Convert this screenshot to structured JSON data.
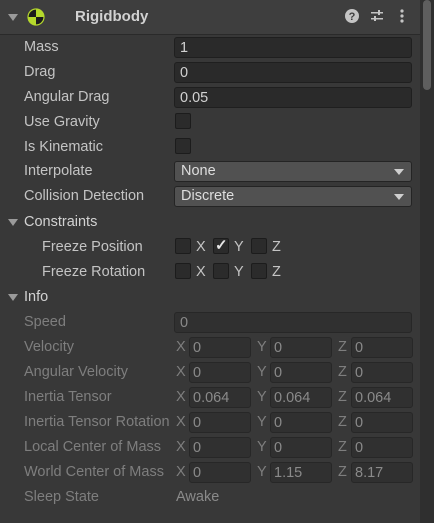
{
  "component": {
    "title": "Rigidbody",
    "icons": [
      "rigidbody-icon",
      "help-icon",
      "presets-icon",
      "more-icon"
    ]
  },
  "props": {
    "mass": {
      "label": "Mass",
      "value": "1"
    },
    "drag": {
      "label": "Drag",
      "value": "0"
    },
    "angular_drag": {
      "label": "Angular Drag",
      "value": "0.05"
    },
    "use_gravity": {
      "label": "Use Gravity",
      "checked": false
    },
    "is_kinematic": {
      "label": "Is Kinematic",
      "checked": false
    },
    "interpolate": {
      "label": "Interpolate",
      "value": "None"
    },
    "collision_detection": {
      "label": "Collision Detection",
      "value": "Discrete"
    }
  },
  "constraints": {
    "label": "Constraints",
    "freeze_position": {
      "label": "Freeze Position",
      "x": false,
      "y": true,
      "z": false
    },
    "freeze_rotation": {
      "label": "Freeze Rotation",
      "x": false,
      "y": false,
      "z": false
    }
  },
  "axes": {
    "x": "X",
    "y": "Y",
    "z": "Z"
  },
  "check_glyph": "✓",
  "info": {
    "label": "Info",
    "speed": {
      "label": "Speed",
      "value": "0"
    },
    "velocity": {
      "label": "Velocity",
      "x": "0",
      "y": "0",
      "z": "0"
    },
    "angular_velocity": {
      "label": "Angular Velocity",
      "x": "0",
      "y": "0",
      "z": "0"
    },
    "inertia_tensor": {
      "label": "Inertia Tensor",
      "x": "0.064",
      "y": "0.064",
      "z": "0.064"
    },
    "inertia_tensor_rotation": {
      "label": "Inertia Tensor Rotation",
      "x": "0",
      "y": "0",
      "z": "0"
    },
    "local_center_of_mass": {
      "label": "Local Center of Mass",
      "x": "0",
      "y": "0",
      "z": "0"
    },
    "world_center_of_mass": {
      "label": "World Center of Mass",
      "x": "0",
      "y": "1.15",
      "z": "8.17"
    },
    "sleep_state": {
      "label": "Sleep State",
      "value": "Awake"
    }
  },
  "colors": {
    "panel_bg": "#383838",
    "field_bg": "#2a2a2a",
    "accent_green": "#b5d92c"
  }
}
